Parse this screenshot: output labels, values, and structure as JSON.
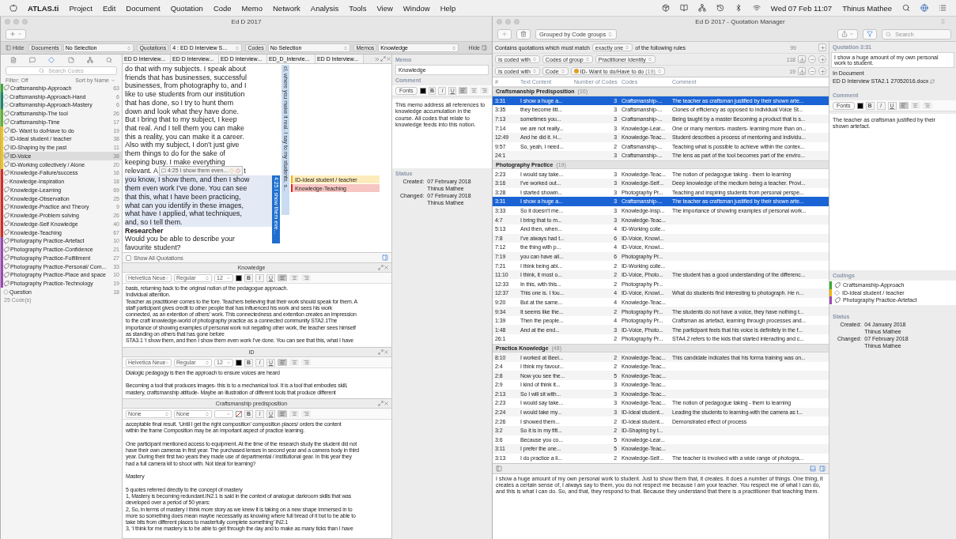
{
  "menu_bar": {
    "app": "ATLAS.ti",
    "items": [
      "Project",
      "Edit",
      "Document",
      "Quotation",
      "Code",
      "Memo",
      "Network",
      "Analysis",
      "Tools",
      "View",
      "Window",
      "Help"
    ],
    "clock": "Wed 07 Feb  11:07",
    "user": "Thinus Mathee"
  },
  "main_window": {
    "title": "Ed D 2017",
    "hide_left": "Hide",
    "hide_right": "Hide",
    "selectors": [
      {
        "label": "Documents",
        "value": "No Selection"
      },
      {
        "label": "Quotations",
        "value": "4 : ED D Interview S..."
      },
      {
        "label": "Codes",
        "value": "No Selection"
      },
      {
        "label": "Memos",
        "value": "Knowledge"
      }
    ],
    "codes": {
      "search_placeholder": "Search Codes",
      "filter": "Filter: Off",
      "sort": "Sort by Name",
      "footer": "25 Code(s)",
      "items": [
        {
          "name": "Craftsmanship-Approach",
          "count": "63",
          "kind": "group",
          "color": "#3aaa35",
          "selected": false
        },
        {
          "name": "Craftsmanship-Approach-Hand",
          "count": "6",
          "kind": "code",
          "color": "#138a6a",
          "selected": false
        },
        {
          "name": "Craftsmanship-Approach-Mastery",
          "count": "6",
          "kind": "code",
          "color": "#138a6a",
          "selected": false
        },
        {
          "name": "Craftsmanship-The tool",
          "count": "26",
          "kind": "group",
          "color": "#5cb82a",
          "selected": false
        },
        {
          "name": "Craftsmanship-Time",
          "count": "17",
          "kind": "group",
          "color": "#5cb82a",
          "selected": false
        },
        {
          "name": "ID- Want to do/Have to do",
          "count": "19",
          "kind": "group",
          "color": "#f5c400",
          "selected": false
        },
        {
          "name": "ID-Ideal student / teacher",
          "count": "38",
          "kind": "code",
          "color": "#f5c400",
          "selected": false
        },
        {
          "name": "ID-Shaping by the past",
          "count": "11",
          "kind": "group",
          "color": "#f5c400",
          "selected": false
        },
        {
          "name": "ID-Voice",
          "count": "38",
          "kind": "group",
          "color": "#f5c400",
          "selected": true
        },
        {
          "name": "ID-Working collectively / Alone",
          "count": "20",
          "kind": "group",
          "color": "#f5c400",
          "selected": false
        },
        {
          "name": "Knowledge-Failure/success",
          "count": "16",
          "kind": "group",
          "color": "#e0281c",
          "selected": false
        },
        {
          "name": "Knowledge-Inspiration",
          "count": "18",
          "kind": "code",
          "color": "#e0281c",
          "selected": false
        },
        {
          "name": "Knowledge-Learning",
          "count": "69",
          "kind": "group",
          "color": "#e0281c",
          "selected": false
        },
        {
          "name": "Knowledge-Observation",
          "count": "25",
          "kind": "group",
          "color": "#e0281c",
          "selected": false
        },
        {
          "name": "Knowledge-Practice and Theory",
          "count": "9",
          "kind": "group",
          "color": "#e0281c",
          "selected": false
        },
        {
          "name": "Knowledge-Problem solving",
          "count": "26",
          "kind": "group",
          "color": "#e0281c",
          "selected": false
        },
        {
          "name": "Knowledge-Self Knowledge",
          "count": "40",
          "kind": "group",
          "color": "#e0281c",
          "selected": false
        },
        {
          "name": "Knowledge-Teaching",
          "count": "67",
          "kind": "group",
          "color": "#e0281c",
          "selected": false
        },
        {
          "name": "Photography Practice-Artefact",
          "count": "10",
          "kind": "group",
          "color": "#a046b8",
          "selected": false
        },
        {
          "name": "Photography Practice-Confidence",
          "count": "21",
          "kind": "group",
          "color": "#a046b8",
          "selected": false
        },
        {
          "name": "Photography Practice-Fulfillment",
          "count": "27",
          "kind": "group",
          "color": "#a046b8",
          "selected": false
        },
        {
          "name": "Photography Practice-Personal/ Com...",
          "count": "33",
          "kind": "group",
          "color": "#a046b8",
          "selected": false
        },
        {
          "name": "Photography Practice-Place and space",
          "count": "10",
          "kind": "group",
          "color": "#a046b8",
          "selected": false
        },
        {
          "name": "Photography Practice-Technology",
          "count": "19",
          "kind": "group",
          "color": "#a046b8",
          "selected": false
        },
        {
          "name": "Question",
          "count": "18",
          "kind": "code",
          "selected": false
        }
      ]
    },
    "document": {
      "tabs": [
        "ED D Interview...",
        "ED D Interview...",
        "ED D Interview...",
        "ED_D_Intervie...",
        "ED D Interview..."
      ],
      "lines": [
        {
          "kind": "plain",
          "text": "do that with my subjects. I speak about",
          "quoted": false
        },
        {
          "kind": "plain",
          "text": "friends that has businesses, successful",
          "quoted": false
        },
        {
          "kind": "plain",
          "text": "businesses, from photography to, and I",
          "quoted": false
        },
        {
          "kind": "plain",
          "text": "like to use students from our institution",
          "quoted": false
        },
        {
          "kind": "plain",
          "text": "that has done, so I try to hunt them",
          "quoted": false
        },
        {
          "kind": "plain",
          "text": "down and look what they have done.",
          "quoted": false
        },
        {
          "kind": "plain",
          "text": "But I bring that to my subject, I keep",
          "quoted": false
        },
        {
          "kind": "plain",
          "text": "that real. And I tell them you can make",
          "quoted": false
        },
        {
          "kind": "plain",
          "text": "this a reality, you can make it a career.",
          "quoted": false
        },
        {
          "kind": "plain",
          "text": "Also with my subject, I don’t just give",
          "quoted": false
        },
        {
          "kind": "plain",
          "text": "them things to do for the sake of",
          "quoted": false
        },
        {
          "kind": "plain",
          "text": "keeping busy. I make everything",
          "quoted": false
        },
        {
          "kind": "tagged",
          "text": "relevant. A",
          "after": "t",
          "tag": "4:25 I show them even...",
          "quoted": false
        },
        {
          "kind": "plain",
          "text": "you know, I show them, and then I show",
          "quoted": true
        },
        {
          "kind": "plain",
          "text": "them even work I’ve done. You can see",
          "quoted": true
        },
        {
          "kind": "plain",
          "text": "that this, what I have been practicing,",
          "quoted": true
        },
        {
          "kind": "plain",
          "text": "what can you identify in these images,",
          "quoted": true
        },
        {
          "kind": "plain",
          "text": "what have I applied, what techniques,",
          "quoted": true
        },
        {
          "kind": "plain",
          "text": "and, so I tell them.",
          "quoted": true
        },
        {
          "kind": "heading",
          "text": "Researcher",
          "quoted": false
        },
        {
          "kind": "plain",
          "text": "Would you be able to describe your",
          "quoted": false
        },
        {
          "kind": "plain",
          "text": "favourite student?",
          "quoted": false
        }
      ],
      "margin": {
        "quotation_text": "cl, where you make it real. I say to my students, s...",
        "quotation_label": "4:25 I show them eve...",
        "codes": [
          {
            "name": "ID-Ideal student / teacher",
            "color": "#f2b300"
          },
          {
            "name": "Knowledge-Teaching",
            "color": "#e0281c"
          }
        ]
      }
    },
    "show_all": {
      "label": "Show All Quotations",
      "checked": false
    },
    "memos": [
      {
        "title": "Knowledge",
        "toolbar": {
          "font": "Helvetica Neue",
          "style": "Regular",
          "size": "12",
          "color_set": true,
          "format": [
            "B",
            "I",
            "U"
          ]
        },
        "paragraphs": [
          [
            "basis, returning back to the original notion of the pedagogue approach.",
            "Individual attention.",
            "Teacher as practitioner comes to the fore. Teachers believing that their work should speak for them. A",
            "staff participant gives credit to other people that has influenced his work and sees his work",
            "connected, as an extention of others’ work. This connectedness and extention creates an impression",
            "to the craft knowledge-world of photography practice as a connected community STA2.1The",
            "importance of showing examples of personal work not negating other work, the teacher sees himself",
            "as standing on others that has gone before",
            "STA3.1 ‘I show them, and then I show them even work I’ve done. You can see that this, what I have"
          ]
        ]
      },
      {
        "title": "ID",
        "toolbar": {
          "font": "Helvetica Neue",
          "style": "Regular",
          "size": "12",
          "color_set": true,
          "format": [
            "B",
            "I",
            "U"
          ]
        },
        "paragraphs": [
          [
            "Dialogic pedagogy is then the approach to ensure voices are heard"
          ],
          [
            "Becoming a tool that produces images- this is to a mechanical tool. It is a tool that embodies skill,",
            "mastery, craftsmanship attitude- Maybe an illustration of different tools that produce different"
          ]
        ]
      },
      {
        "title": "Craftsmanship predisposition",
        "toolbar": {
          "font": "None",
          "style": "None",
          "color_set": false,
          "format": [
            "B",
            "I",
            "U"
          ]
        },
        "paragraphs": [
          [
            "acceptable final result. ‘Until I get the right composition’ composition places/ orders the content",
            "within the frame Composition may be an important aspect of practice learning."
          ],
          [
            "One participant mentioned access to equipment. At the time of the research study the student did not",
            "have their own cameras in first year. The purchased lenses in second year and a camera body in third",
            "year. During their first two years they made use of departmental / institutional gear. In this year they",
            "had a full camera kit to shoot with. Not ideal for learning?"
          ],
          [
            "Mastery"
          ],
          [
            "5 quotes referred directly to the concept of mastery",
            "1, Mastery is becoming redundant.IN2.1 is said in the context of analogue darkroom skills that was",
            "developed over a period of 50 years:",
            "2, So, in terms of mastery I think more story as we knew it is taking on a new shape immersed in to",
            "more so something does mean maybe necessarily as knowing where full bread of it but to be able to",
            "take bits from different places to masterfully complete something’ IN2.1",
            "3, ‘I think for me mastery is to be able to get through the day and to make as many ticks than I have"
          ]
        ]
      }
    ],
    "inspector": {
      "memo_label": "Memo",
      "name": "Knowledge",
      "comment_label": "Comment",
      "toolbar": {
        "fonts": "Fonts",
        "format": [
          "B",
          "I",
          "U"
        ]
      },
      "comment": "This memo address all references to knowledge accumulation in the course. All codes that relate to knowledge feeds into this notion.",
      "status_label": "Status",
      "created_label": "Created:",
      "created": "07 February 2018",
      "created_by": "Thinus Mathee",
      "changed_label": "Changed:",
      "changed": "07 February 2018",
      "changed_by": "Thinus Mathee"
    }
  },
  "quotation_manager": {
    "title": "Ed D 2017 - Quotation Manager",
    "grouping": "Grouped by Code groups",
    "search_placeholder": "Search",
    "match": {
      "prefix": "Contains quotations which must match",
      "mode": "exactly one",
      "suffix": "of the following rules",
      "count": "99"
    },
    "rules": [
      {
        "fields": [
          {
            "text": "Is coded with"
          },
          {
            "text": "Codes of group"
          },
          {
            "text": "Practitioner Identity"
          }
        ],
        "count": "118"
      },
      {
        "fields": [
          {
            "text": "Is coded with"
          },
          {
            "text": "Code"
          },
          {
            "text": "ID- Want to do/Have to do",
            "suffix": "(19)",
            "color": "#e0a020"
          }
        ],
        "count": "19"
      }
    ],
    "columns": [
      "#",
      "Text Content",
      "Number of Codes",
      "Codes",
      "Comment"
    ],
    "groups": [
      {
        "name": "Craftsmanship Predisposition",
        "count": "(10)",
        "rows": [
          {
            "cells": [
              "3:31",
              "I show a huge a...",
              "3",
              "Craftsmanship-...",
              "The teacher as craftsman justified by their shown arte..."
            ],
            "selected": true
          },
          {
            "cells": [
              "3:35",
              "they become litt...",
              "3",
              "Craftsmanship-...",
              "Clones of efficiency as opposed to individual Voice St..."
            ],
            "selected": false
          },
          {
            "cells": [
              "7:13",
              "sometimes you...",
              "3",
              "Craftsmanship-...",
              "Being taught by a master Becoming a product that is s..."
            ],
            "selected": false
          },
          {
            "cells": [
              "7:14",
              "we are not really...",
              "3",
              "Knowledge-Lear...",
              "One or many mentors- masters- learning more than on..."
            ],
            "selected": false
          },
          {
            "cells": [
              "12:49",
              "And he did it. H...",
              "3",
              "Knowledge-Teac...",
              "Student describes a process of mentoring and individu..."
            ],
            "selected": false
          },
          {
            "cells": [
              "9:57",
              "So, yeah, I need...",
              "2",
              "Craftsmanship-...",
              "Teaching what is possible to achieve within the contex..."
            ],
            "selected": false
          },
          {
            "cells": [
              "24:1",
              null,
              "3",
              "Craftsmanship-...",
              "The lens as part of the tool becomes part of the enviro..."
            ],
            "selected": false
          }
        ]
      },
      {
        "name": "Photography Practice",
        "count": "(19)",
        "rows": [
          {
            "cells": [
              "2:23",
              "I would say take...",
              "3",
              "Knowledge-Teac...",
              "The notion of pedagogue taking - them to learning"
            ],
            "selected": false
          },
          {
            "cells": [
              "3:16",
              "I’ve worked out...",
              "3",
              "Knowledge-Self...",
              "Deep knowledge of the medium being a  teacher. Provi..."
            ],
            "selected": false
          },
          {
            "cells": [
              "3:28",
              "I started showin...",
              "3",
              "Photography Pr...",
              "Teaching and inspiring students from personal perspe..."
            ],
            "selected": false
          },
          {
            "cells": [
              "3:31",
              "I show a huge a...",
              "3",
              "Craftsmanship-...",
              "The teacher as craftsman justified by their shown arte..."
            ],
            "selected": true
          },
          {
            "cells": [
              "3:33",
              "So it doesn’t me...",
              "3",
              "Knowledge-Insp...",
              "The importance of showing examples of personal work..."
            ],
            "selected": false
          },
          {
            "cells": [
              "4:7",
              "I bring that to m...",
              "3",
              "Knowledge-Teac...",
              null
            ],
            "selected": false
          },
          {
            "cells": [
              "5:13",
              "And then, when...",
              "4",
              "ID-Working colle...",
              null
            ],
            "selected": false
          },
          {
            "cells": [
              "7:8",
              "I’ve always had t...",
              "6",
              "ID-Voice, Knowl...",
              null
            ],
            "selected": false
          },
          {
            "cells": [
              "7:12",
              "the thing with p...",
              "4",
              "ID-Voice, Knowl...",
              null
            ],
            "selected": false
          },
          {
            "cells": [
              "7:19",
              "you can have all...",
              "6",
              "Photography Pr...",
              null
            ],
            "selected": false
          },
          {
            "cells": [
              "7:21",
              "I think being abl...",
              "2",
              "ID-Working colle...",
              null
            ],
            "selected": false
          },
          {
            "cells": [
              "11:10",
              "I think, it most o...",
              "2",
              "ID-Voice, Photo...",
              "The student has a good understanding of the differenc..."
            ],
            "selected": false
          },
          {
            "cells": [
              "12:33",
              "In this, with this...",
              "2",
              "Photography Pr...",
              null
            ],
            "selected": false
          },
          {
            "cells": [
              "12:37",
              "This one is. I fou...",
              "4",
              "ID-Voice, Knowl...",
              "What do students find interesting to photograph. He n..."
            ],
            "selected": false
          },
          {
            "cells": [
              "9:20",
              "But at the same...",
              "4",
              "Knowledge-Teac...",
              null
            ],
            "selected": false
          },
          {
            "cells": [
              "9:34",
              "It seems like the...",
              "2",
              "Photography Pr...",
              "The students do not have a voice, they have nothing t..."
            ],
            "selected": false
          },
          {
            "cells": [
              "1:39",
              "Then the people...",
              "4",
              "Photography Pr...",
              "Craftsman as artefact, learning through processes and..."
            ],
            "selected": false
          },
          {
            "cells": [
              "1:48",
              "And at the end...",
              "3",
              "ID-Voice, Photo...",
              "The participant feels that his voice is definitely in the f..."
            ],
            "selected": false
          },
          {
            "cells": [
              "26:1",
              null,
              "2",
              "Photography Pr...",
              "STA4.2 refers to the kids that started interacting and c..."
            ],
            "selected": false
          }
        ]
      },
      {
        "name": "Practica Knowledge",
        "count": "(48)",
        "rows": [
          {
            "cells": [
              "8:10",
              "I worked at Beel...",
              "2",
              "Knowledge-Teac...",
              "This candidate indicates that his forma training was on..."
            ],
            "selected": false
          },
          {
            "cells": [
              "2:4",
              "I think my favour...",
              "2",
              "Knowledge-Teac...",
              null
            ],
            "selected": false
          },
          {
            "cells": [
              "2:8",
              "Now you see the...",
              "5",
              "Knowledge-Teac...",
              null
            ],
            "selected": false
          },
          {
            "cells": [
              "2:9",
              "I kind of think it...",
              "3",
              "Knowledge-Teac...",
              null
            ],
            "selected": false
          },
          {
            "cells": [
              "2:13",
              "So I will sit with...",
              "3",
              "Knowledge-Teac...",
              null
            ],
            "selected": false
          },
          {
            "cells": [
              "2:23",
              "I would say take...",
              "3",
              "Knowledge-Teac...",
              "The notion of pedagogue taking - them to learning"
            ],
            "selected": false
          },
          {
            "cells": [
              "2:24",
              "I would take my...",
              "3",
              "ID-Ideal student...",
              "Leading the students to learning-with the camera as t..."
            ],
            "selected": false
          },
          {
            "cells": [
              "2:26",
              "I showed them...",
              "2",
              "ID-Ideal student...",
              "Demonstrated effect of process"
            ],
            "selected": false
          },
          {
            "cells": [
              "3:2",
              "So it is in my fift...",
              "2",
              "ID-Shaping by t...",
              null
            ],
            "selected": false
          },
          {
            "cells": [
              "3:6",
              "Because you co...",
              "5",
              "Knowledge-Lear...",
              null
            ],
            "selected": false
          },
          {
            "cells": [
              "3:11",
              "I prefer the one...",
              "5",
              "Knowledge-Teac...",
              null
            ],
            "selected": false
          },
          {
            "cells": [
              "3:13",
              "I do practice a li...",
              "2",
              "Knowledge-Self...",
              "The teacher is involved with a wide range of photogra..."
            ],
            "selected": false
          }
        ]
      }
    ],
    "preview": "I show a huge amount of my own personal work to student. Just to show them that, it creates. It does a number of things. One thing, it creates a certain sense of, I always say to them, you do not respect me because I am your teacher. You respect me of what I can do, and this is what I can do. So, and that, they respond to that. Because they understand that there is a practitioner that teaching them.",
    "inspector": {
      "heading": "Quotation 3:31",
      "text": "I show a huge amount of my own personal work to student.",
      "document_label": "In Document",
      "document": "ED D Interview STA2.1 27052016.docx",
      "comment_label": "Comment",
      "toolbar": {
        "fonts": "Fonts",
        "format": [
          "B",
          "I",
          "U"
        ]
      },
      "comment": "The teacher as craftsman justified by their shown artefact.",
      "codings_label": "Codings",
      "codings": [
        {
          "name": "Craftsmanship-Approach",
          "kind": "group",
          "color": "#3aaa35"
        },
        {
          "name": "ID-Ideal student / teacher",
          "kind": "code",
          "color": "#f2b300"
        },
        {
          "name": "Photography Practice-Artefact",
          "kind": "group",
          "color": "#a046b8"
        }
      ],
      "status_label": "Status",
      "created_label": "Created:",
      "created": "04 January 2018",
      "created_by": "Thinus Mathee",
      "changed_label": "Changed:",
      "changed": "07 February 2018",
      "changed_by": "Thinus Mathee"
    }
  }
}
